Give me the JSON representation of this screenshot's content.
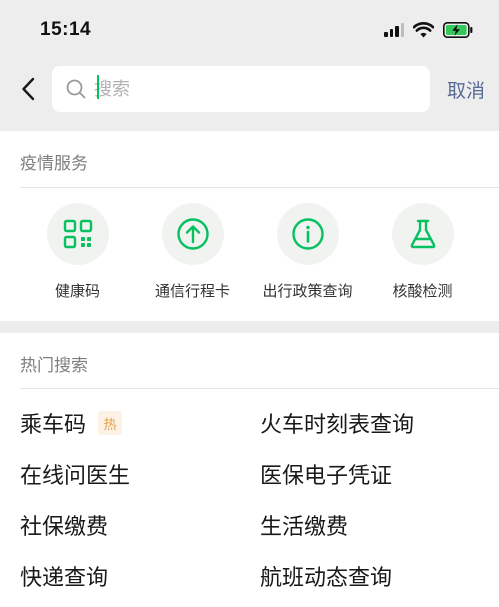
{
  "status_bar": {
    "time": "15:14",
    "icons": [
      "signal-icon",
      "wifi-icon",
      "battery-charging-icon"
    ]
  },
  "search": {
    "placeholder": "搜索",
    "value": "",
    "cancel_label": "取消"
  },
  "services_section": {
    "title": "疫情服务",
    "items": [
      {
        "label": "健康码",
        "icon": "qr-code-icon"
      },
      {
        "label": "通信行程卡",
        "icon": "arrow-up-circle-icon"
      },
      {
        "label": "出行政策查询",
        "icon": "info-circle-icon"
      },
      {
        "label": "核酸检测",
        "icon": "flask-icon"
      }
    ]
  },
  "hot_search": {
    "title": "热门搜索",
    "items": [
      {
        "label": "乘车码",
        "badge": "热"
      },
      {
        "label": "火车时刻表查询",
        "badge": ""
      },
      {
        "label": "在线问医生",
        "badge": ""
      },
      {
        "label": "医保电子凭证",
        "badge": ""
      },
      {
        "label": "社保缴费",
        "badge": ""
      },
      {
        "label": "生活缴费",
        "badge": ""
      },
      {
        "label": "快递查询",
        "badge": ""
      },
      {
        "label": "航班动态查询",
        "badge": ""
      }
    ]
  },
  "colors": {
    "accent_green": "#07c160",
    "link_blue": "#576b95",
    "hot_badge_bg": "#fbf1e4",
    "hot_badge_text": "#e6a04a",
    "page_bg": "#ededed"
  }
}
